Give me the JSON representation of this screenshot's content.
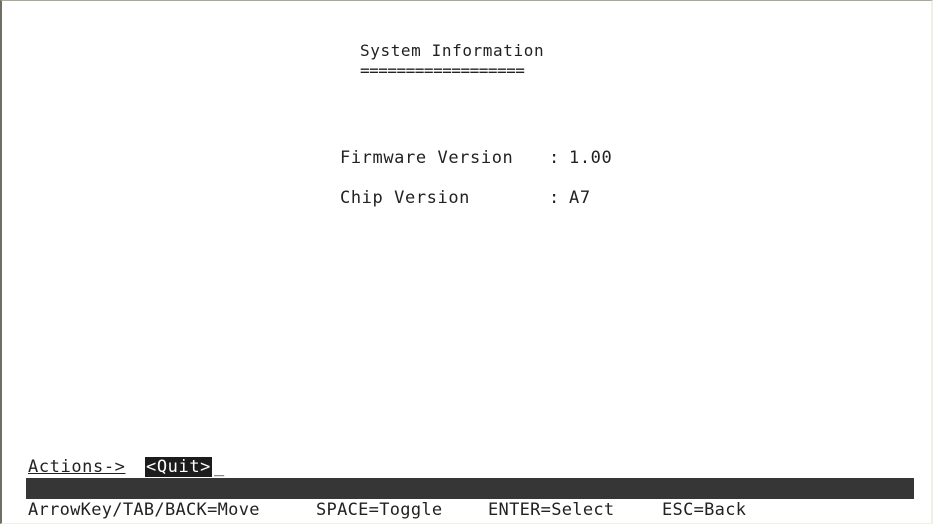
{
  "screen": {
    "title": "System Information",
    "title_underline": "=================="
  },
  "info": {
    "rows": [
      {
        "label": "Firmware Version",
        "separator": ":",
        "value": "1.00"
      },
      {
        "label": "Chip Version",
        "separator": ":",
        "value": "A7"
      }
    ]
  },
  "actions": {
    "label": "Actions->",
    "items": [
      "<Quit>"
    ],
    "cursor": "_"
  },
  "help": {
    "items": [
      "ArrowKey/TAB/BACK=Move",
      "SPACE=Toggle",
      "ENTER=Select",
      "ESC=Back"
    ]
  },
  "colors": {
    "background": "#ffffff",
    "text": "#222222",
    "status_bar": "#363636",
    "highlight_bg": "#1c1c1c",
    "highlight_fg": "#ffffff"
  }
}
